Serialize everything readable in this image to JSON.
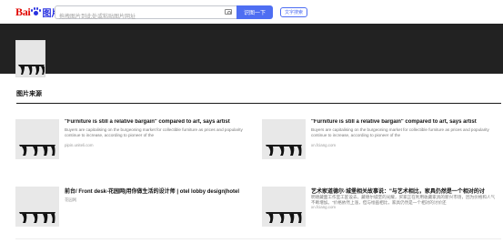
{
  "header": {
    "logo_bai": "Bai",
    "logo_du": "du",
    "logo_tu": "图片",
    "search_placeholder": "拖拽图片到此处或粘贴图片网址",
    "search_button": "识图一下",
    "text_search_button": "文字搜索"
  },
  "section": {
    "title": "图片来源"
  },
  "results": [
    {
      "title": "\"Furniture is still a relative bargain\" compared to art, says artist",
      "desc": "Buyers are capitalising on the burgeoning market for collectible furniture as prices and popularity continue to increase, according to pioneer of the",
      "source": "pipin.uniteli.com"
    },
    {
      "title": "\"Furniture is still a relative bargain\" compared to art, says artist",
      "desc": "Buyers are capitalising on the burgeoning market for collectible furniture as prices and popularity continue to increase, according to pioneer of the",
      "source": "xn.fciang.com"
    },
    {
      "title": "前台/ Front desk-花园网|用你做生活的设计师 | otel lobby design|hotel",
      "desc": "",
      "source": "花园网"
    },
    {
      "title": "艺术家道德尔·城堡相关故事说：\"与艺术相比，家具仍然是一个相对的讨",
      "desc": "明德藏面工作室工匠设去，藏德尔城堡的光耀，买家正在利用收藏家具的新兴市场，因为价格和人气不断增加。\"价格依然上涨，但与绘画相比，家具仍然是一个相对的讨价还",
      "source": "xn.fciang.com"
    }
  ]
}
